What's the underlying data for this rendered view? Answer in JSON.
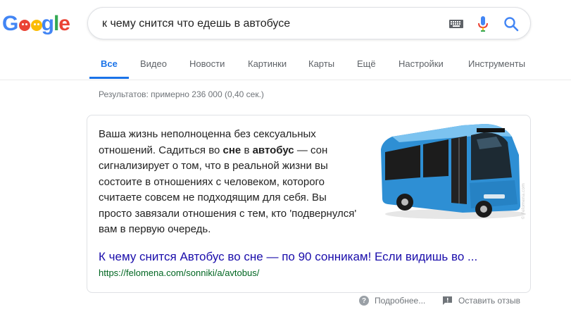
{
  "logo": {
    "g1": "G",
    "g2": "g",
    "l": "l",
    "e": "e"
  },
  "search": {
    "query": "к чему снится что едешь в автобусе"
  },
  "tabs": [
    {
      "label": "Все"
    },
    {
      "label": "Видео"
    },
    {
      "label": "Новости"
    },
    {
      "label": "Картинки"
    },
    {
      "label": "Карты"
    },
    {
      "label": "Ещё"
    },
    {
      "label": "Настройки"
    },
    {
      "label": "Инструменты"
    }
  ],
  "stats": "Результатов: примерно 236 000 (0,40 сек.)",
  "snippet": {
    "p1": "Ваша жизнь неполноценна без сексуальных отношений. Садиться во ",
    "b1": "сне",
    "p2": " в ",
    "b2": "автобус",
    "p3": " — сон сигнализирует о том, что в реальной жизни вы состоите в отношениях с человеком, которого считаете совсем не подходящим для себя. Вы просто завязали отношения с тем, кто 'подвернулся' вам в первую очередь.",
    "image_watermark": "© Felomena.com"
  },
  "result": {
    "title": "К чему снится Автобус во сне — по 90 сонникам! Если видишь во ...",
    "url": "https://felomena.com/sonniki/a/avtobus/"
  },
  "footer": {
    "more": "Подробнее...",
    "feedback": "Оставить отзыв"
  },
  "colors": {
    "accent": "#1a73e8",
    "link": "#1a0dab",
    "url": "#006621",
    "bus": "#2e8fd4"
  }
}
